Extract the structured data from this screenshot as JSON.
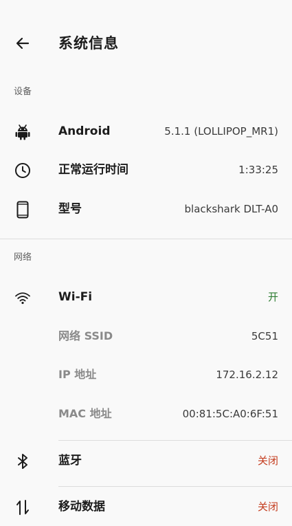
{
  "header": {
    "title": "系统信息"
  },
  "sections": {
    "device": {
      "header": "设备",
      "android": {
        "label": "Android",
        "value": "5.1.1 (LOLLIPOP_MR1)"
      },
      "uptime": {
        "label": "正常运行时间",
        "value": "1:33:25"
      },
      "model": {
        "label": "型号",
        "value": "blackshark DLT-A0"
      }
    },
    "network": {
      "header": "网络",
      "wifi": {
        "label": "Wi-Fi",
        "value": "开"
      },
      "ssid": {
        "label": "网络 SSID",
        "value": "5C51"
      },
      "ip": {
        "label": "IP 地址",
        "value": "172.16.2.12"
      },
      "mac": {
        "label": "MAC 地址",
        "value": "00:81:5C:A0:6F:51"
      },
      "bluetooth": {
        "label": "蓝牙",
        "value": "关闭"
      },
      "mobile_data": {
        "label": "移动数据",
        "value": "关闭"
      }
    }
  },
  "colors": {
    "on": "#2e7d32",
    "off": "#c43c1e"
  },
  "icons": {
    "back": "arrow-left-icon",
    "android": "android-icon",
    "uptime": "clock-icon",
    "model": "phone-icon",
    "wifi": "wifi-icon",
    "bluetooth": "bluetooth-icon",
    "mobile_data": "mobile-data-icon"
  }
}
